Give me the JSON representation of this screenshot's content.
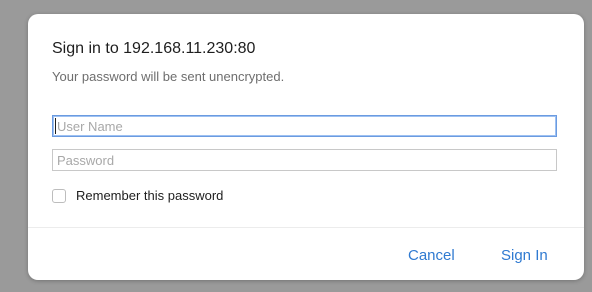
{
  "dialog": {
    "title": "Sign in to 192.168.11.230:80",
    "subtitle": "Your password will be sent unencrypted.",
    "username": {
      "value": "",
      "placeholder": "User Name"
    },
    "password": {
      "value": "",
      "placeholder": "Password"
    },
    "remember": {
      "label": "Remember this password",
      "checked": false
    },
    "buttons": {
      "cancel_label": "Cancel",
      "signin_label": "Sign In"
    }
  },
  "colors": {
    "accent": "#2f7ad1",
    "focus_ring": "#6b9be0",
    "backdrop": "#9a9a9a"
  }
}
